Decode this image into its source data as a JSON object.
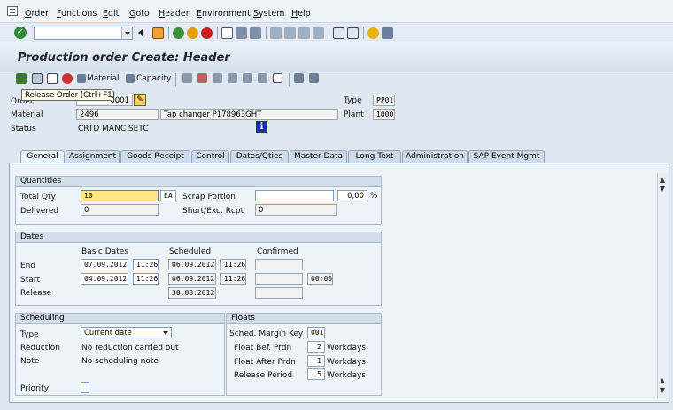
{
  "menu": [
    "Order",
    "Functions",
    "Edit",
    "Goto",
    "Header",
    "Environment",
    "System",
    "Help"
  ],
  "title": "Production order Create: Header",
  "app_toolbar": {
    "material": "Material",
    "capacity": "Capacity"
  },
  "tooltip": "Release Order  (Ctrl+F1)",
  "header": {
    "order_label": "Order",
    "order_value": "0001",
    "type_label": "Type",
    "type_value": "PP01",
    "material_label": "Material",
    "material_value": "2496",
    "material_desc": "Tap changer P178963GHT",
    "plant_label": "Plant",
    "plant_value": "1000",
    "status_label": "Status",
    "status_value": "CRTD MANC SETC"
  },
  "tabs": [
    "General",
    "Assignment",
    "Goods Receipt",
    "Control",
    "Dates/Qties",
    "Master Data",
    "Long Text",
    "Administration",
    "SAP Event Mgmt"
  ],
  "active_tab": "General",
  "quantities": {
    "title": "Quantities",
    "total_qty_label": "Total Qty",
    "total_qty": "10",
    "uom": "EA",
    "scrap_label": "Scrap Portion",
    "scrap_value": "",
    "scrap_pct": "0,00",
    "pct_sign": "%",
    "delivered_label": "Delivered",
    "delivered": "0",
    "short_label": "Short/Exc. Rcpt",
    "short_value": "0"
  },
  "dates": {
    "title": "Dates",
    "basic_header": "Basic Dates",
    "scheduled_header": "Scheduled",
    "confirmed_header": "Confirmed",
    "end_label": "End",
    "end_basic_date": "07.09.2012",
    "end_basic_time": "11:26",
    "end_sched_date": "06.09.2012",
    "end_sched_time": "11:26",
    "start_label": "Start",
    "start_basic_date": "04.09.2012",
    "start_basic_time": "11:26",
    "start_sched_date": "06.09.2012",
    "start_sched_time": "11:26",
    "start_conf_time": "00:00",
    "release_label": "Release",
    "release_sched_date": "30.08.2012"
  },
  "scheduling": {
    "title": "Scheduling",
    "type_label": "Type",
    "type_value": "Current date",
    "reduction_label": "Reduction",
    "reduction_value": "No reduction carried out",
    "note_label": "Note",
    "note_value": "No scheduling note",
    "priority_label": "Priority"
  },
  "floats": {
    "title": "Floats",
    "margin_key_label": "Sched. Margin Key",
    "margin_key": "001",
    "before_label": "Float Bef. Prdn",
    "before_value": "2",
    "before_unit": "Workdays",
    "after_label": "Float After Prdn",
    "after_value": "1",
    "after_unit": "Workdays",
    "release_label": "Release Period",
    "release_value": "5",
    "release_unit": "Workdays"
  },
  "colors": {
    "accent": "#ffe680",
    "panel": "#eef3f9",
    "tab": "#cfdbea"
  }
}
